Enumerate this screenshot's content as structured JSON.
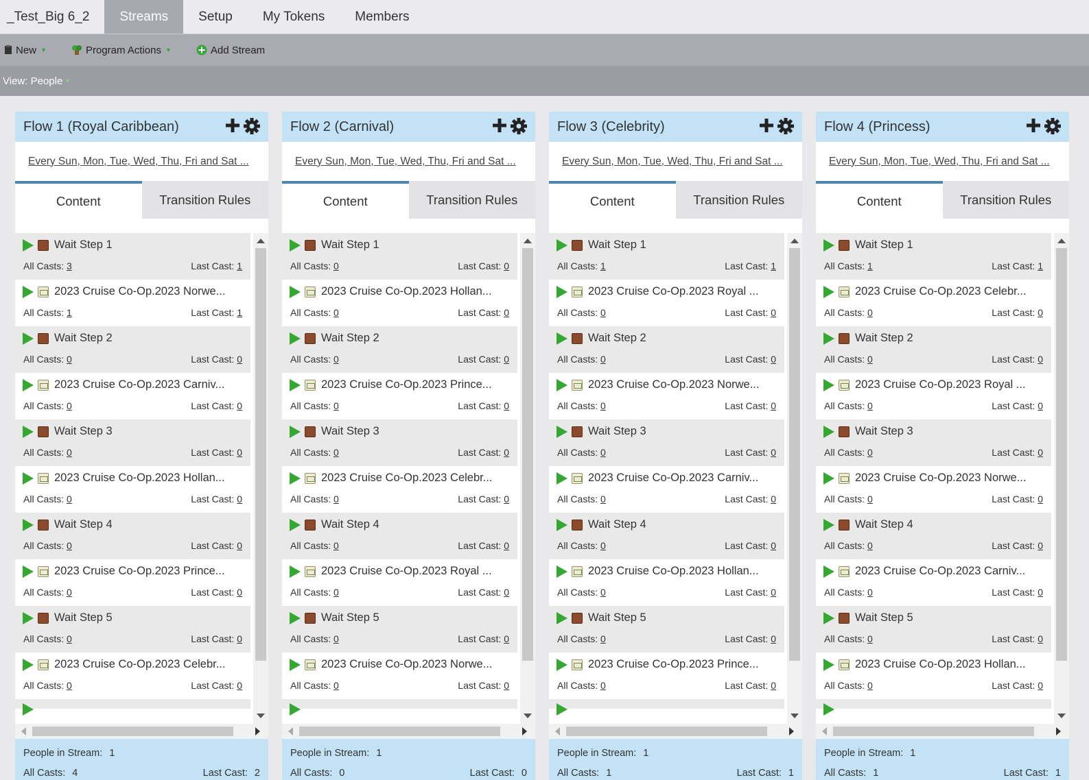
{
  "program_tab": "_Test_Big 6_2",
  "nav_tabs": [
    "Streams",
    "Setup",
    "My Tokens",
    "Members"
  ],
  "toolbar": {
    "new_label": "New",
    "program_actions_label": "Program Actions",
    "add_stream_label": "Add Stream"
  },
  "view_label": "View: People",
  "tab_labels": {
    "content": "Content",
    "transition": "Transition Rules"
  },
  "labels": {
    "all_casts": "All Casts:",
    "last_cast": "Last Cast:",
    "people_in_stream": "People in Stream:"
  },
  "streams": [
    {
      "title": "Flow 1 (Royal Caribbean)",
      "schedule": "Every Sun, Mon, Tue, Wed, Thu, Fri and Sat ...",
      "people_in_stream": "1",
      "all_casts": "4",
      "last_cast": "2",
      "steps": [
        {
          "type": "wait",
          "name": "Wait Step 1",
          "all": "3",
          "last": "1"
        },
        {
          "type": "email",
          "name": "2023 Cruise Co-Op.2023 Norwe...",
          "all": "1",
          "last": "1"
        },
        {
          "type": "wait",
          "name": "Wait Step 2",
          "all": "0",
          "last": "0"
        },
        {
          "type": "email",
          "name": "2023 Cruise Co-Op.2023 Carniv...",
          "all": "0",
          "last": "0"
        },
        {
          "type": "wait",
          "name": "Wait Step 3",
          "all": "0",
          "last": "0"
        },
        {
          "type": "email",
          "name": "2023 Cruise Co-Op.2023 Hollan...",
          "all": "0",
          "last": "0"
        },
        {
          "type": "wait",
          "name": "Wait Step 4",
          "all": "0",
          "last": "0"
        },
        {
          "type": "email",
          "name": "2023 Cruise Co-Op.2023 Prince...",
          "all": "0",
          "last": "0"
        },
        {
          "type": "wait",
          "name": "Wait Step 5",
          "all": "0",
          "last": "0"
        },
        {
          "type": "email",
          "name": "2023 Cruise Co-Op.2023 Celebr...",
          "all": "0",
          "last": "0"
        }
      ]
    },
    {
      "title": "Flow 2 (Carnival)",
      "schedule": "Every Sun, Mon, Tue, Wed, Thu, Fri and Sat ...",
      "people_in_stream": "1",
      "all_casts": "0",
      "last_cast": "0",
      "steps": [
        {
          "type": "wait",
          "name": "Wait Step 1",
          "all": "0",
          "last": "0"
        },
        {
          "type": "email",
          "name": "2023 Cruise Co-Op.2023 Hollan...",
          "all": "0",
          "last": "0"
        },
        {
          "type": "wait",
          "name": "Wait Step 2",
          "all": "0",
          "last": "0"
        },
        {
          "type": "email",
          "name": "2023 Cruise Co-Op.2023 Prince...",
          "all": "0",
          "last": "0"
        },
        {
          "type": "wait",
          "name": "Wait Step 3",
          "all": "0",
          "last": "0"
        },
        {
          "type": "email",
          "name": "2023 Cruise Co-Op.2023 Celebr...",
          "all": "0",
          "last": "0"
        },
        {
          "type": "wait",
          "name": "Wait Step 4",
          "all": "0",
          "last": "0"
        },
        {
          "type": "email",
          "name": "2023 Cruise Co-Op.2023 Royal ...",
          "all": "0",
          "last": "0"
        },
        {
          "type": "wait",
          "name": "Wait Step 5",
          "all": "0",
          "last": "0"
        },
        {
          "type": "email",
          "name": "2023 Cruise Co-Op.2023 Norwe...",
          "all": "0",
          "last": "0"
        }
      ]
    },
    {
      "title": "Flow 3 (Celebrity)",
      "schedule": "Every Sun, Mon, Tue, Wed, Thu, Fri and Sat ...",
      "people_in_stream": "1",
      "all_casts": "1",
      "last_cast": "1",
      "steps": [
        {
          "type": "wait",
          "name": "Wait Step 1",
          "all": "1",
          "last": "1"
        },
        {
          "type": "email",
          "name": "2023 Cruise Co-Op.2023 Royal ...",
          "all": "0",
          "last": "0"
        },
        {
          "type": "wait",
          "name": "Wait Step 2",
          "all": "0",
          "last": "0"
        },
        {
          "type": "email",
          "name": "2023 Cruise Co-Op.2023 Norwe...",
          "all": "0",
          "last": "0"
        },
        {
          "type": "wait",
          "name": "Wait Step 3",
          "all": "0",
          "last": "0"
        },
        {
          "type": "email",
          "name": "2023 Cruise Co-Op.2023 Carniv...",
          "all": "0",
          "last": "0"
        },
        {
          "type": "wait",
          "name": "Wait Step 4",
          "all": "0",
          "last": "0"
        },
        {
          "type": "email",
          "name": "2023 Cruise Co-Op.2023 Hollan...",
          "all": "0",
          "last": "0"
        },
        {
          "type": "wait",
          "name": "Wait Step 5",
          "all": "0",
          "last": "0"
        },
        {
          "type": "email",
          "name": "2023 Cruise Co-Op.2023 Prince...",
          "all": "0",
          "last": "0"
        }
      ]
    },
    {
      "title": "Flow 4 (Princess)",
      "schedule": "Every Sun, Mon, Tue, Wed, Thu, Fri and Sat ...",
      "people_in_stream": "1",
      "all_casts": "1",
      "last_cast": "1",
      "steps": [
        {
          "type": "wait",
          "name": "Wait Step 1",
          "all": "1",
          "last": "1"
        },
        {
          "type": "email",
          "name": "2023 Cruise Co-Op.2023 Celebr...",
          "all": "0",
          "last": "0"
        },
        {
          "type": "wait",
          "name": "Wait Step 2",
          "all": "0",
          "last": "0"
        },
        {
          "type": "email",
          "name": "2023 Cruise Co-Op.2023 Royal ...",
          "all": "0",
          "last": "0"
        },
        {
          "type": "wait",
          "name": "Wait Step 3",
          "all": "0",
          "last": "0"
        },
        {
          "type": "email",
          "name": "2023 Cruise Co-Op.2023 Norwe...",
          "all": "0",
          "last": "0"
        },
        {
          "type": "wait",
          "name": "Wait Step 4",
          "all": "0",
          "last": "0"
        },
        {
          "type": "email",
          "name": "2023 Cruise Co-Op.2023 Carniv...",
          "all": "0",
          "last": "0"
        },
        {
          "type": "wait",
          "name": "Wait Step 5",
          "all": "0",
          "last": "0"
        },
        {
          "type": "email",
          "name": "2023 Cruise Co-Op.2023 Hollan...",
          "all": "0",
          "last": "0"
        }
      ]
    }
  ],
  "colors": {
    "header_blue": "#c3e2f5",
    "tab_accent": "#4d86b0",
    "play_green": "#35a832",
    "active_tab": "#a7a9b1"
  }
}
